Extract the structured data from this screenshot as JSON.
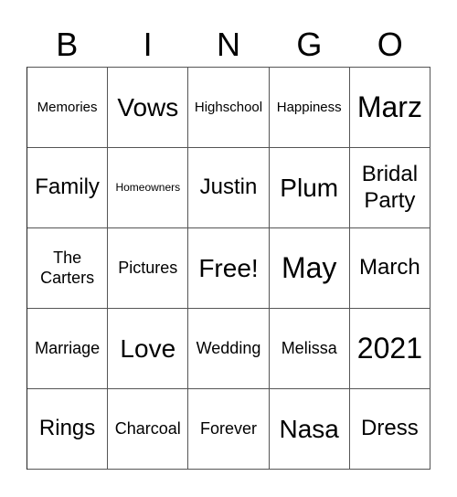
{
  "header": {
    "letters": [
      "B",
      "I",
      "N",
      "G",
      "O"
    ]
  },
  "cells": [
    {
      "text": "Memories",
      "size": "sm"
    },
    {
      "text": "Vows",
      "size": "xl"
    },
    {
      "text": "Highschool",
      "size": "sm"
    },
    {
      "text": "Happiness",
      "size": "sm"
    },
    {
      "text": "Marz",
      "size": "xxl"
    },
    {
      "text": "Family",
      "size": "lg"
    },
    {
      "text": "Homeowners",
      "size": "xs"
    },
    {
      "text": "Justin",
      "size": "lg"
    },
    {
      "text": "Plum",
      "size": "xl"
    },
    {
      "text": "Bridal Party",
      "size": "lg"
    },
    {
      "text": "The Carters",
      "size": "md"
    },
    {
      "text": "Pictures",
      "size": "md"
    },
    {
      "text": "Free!",
      "size": "xl"
    },
    {
      "text": "May",
      "size": "xxl"
    },
    {
      "text": "March",
      "size": "lg"
    },
    {
      "text": "Marriage",
      "size": "md"
    },
    {
      "text": "Love",
      "size": "xl"
    },
    {
      "text": "Wedding",
      "size": "md"
    },
    {
      "text": "Melissa",
      "size": "md"
    },
    {
      "text": "2021",
      "size": "xxl"
    },
    {
      "text": "Rings",
      "size": "lg"
    },
    {
      "text": "Charcoal",
      "size": "md"
    },
    {
      "text": "Forever",
      "size": "md"
    },
    {
      "text": "Nasa",
      "size": "xl"
    },
    {
      "text": "Dress",
      "size": "lg"
    }
  ]
}
